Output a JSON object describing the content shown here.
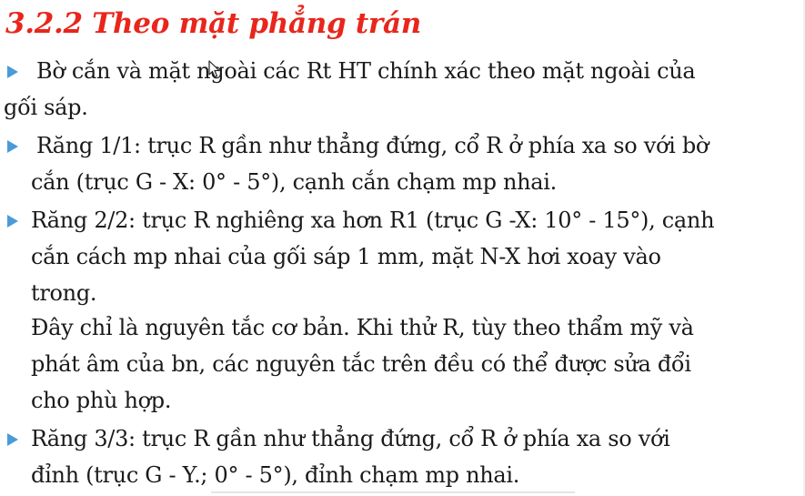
{
  "title": "3.2.2 Theo mặt phẳng trán",
  "colors": {
    "title": "#e8261c",
    "bullet": "#4a9bd6",
    "text": "#1a1a1a"
  },
  "icons": {
    "bullet": "triangle-right-icon",
    "cursor": "mouse-pointer-icon"
  },
  "paragraphs": [
    {
      "bullet": true,
      "lines": [
        "Bờ cắn và mặt ngoài các Rt HT chính xác theo mặt ngoài của",
        "gối sáp."
      ]
    },
    {
      "bullet": true,
      "lines": [
        "Răng 1/1: trục R gần như thẳng đứng, cổ R ở phía xa so với bờ",
        "cắn (trục G - X: 0° - 5°), cạnh cắn chạm mp nhai."
      ]
    },
    {
      "bullet": true,
      "lines": [
        "Răng 2/2: trục R nghiêng xa hơn R1 (trục G -X: 10° - 15°), cạnh",
        "cắn cách mp nhai của gối sáp 1 mm, mặt N-X hơi xoay  vào",
        "trong."
      ]
    },
    {
      "bullet": false,
      "lines": [
        "Đây chỉ là nguyên tắc cơ bản. Khi thử R, tùy theo thẩm mỹ và",
        "phát âm của bn, các nguyên tắc trên đều có thể được sửa đổi",
        "cho phù hợp."
      ]
    },
    {
      "bullet": true,
      "lines": [
        "Răng 3/3: trục R gần như thẳng đứng, cổ R ở phía xa so với",
        "đỉnh (trục G - Y.; 0° - 5°), đỉnh chạm mp nhai."
      ]
    }
  ]
}
